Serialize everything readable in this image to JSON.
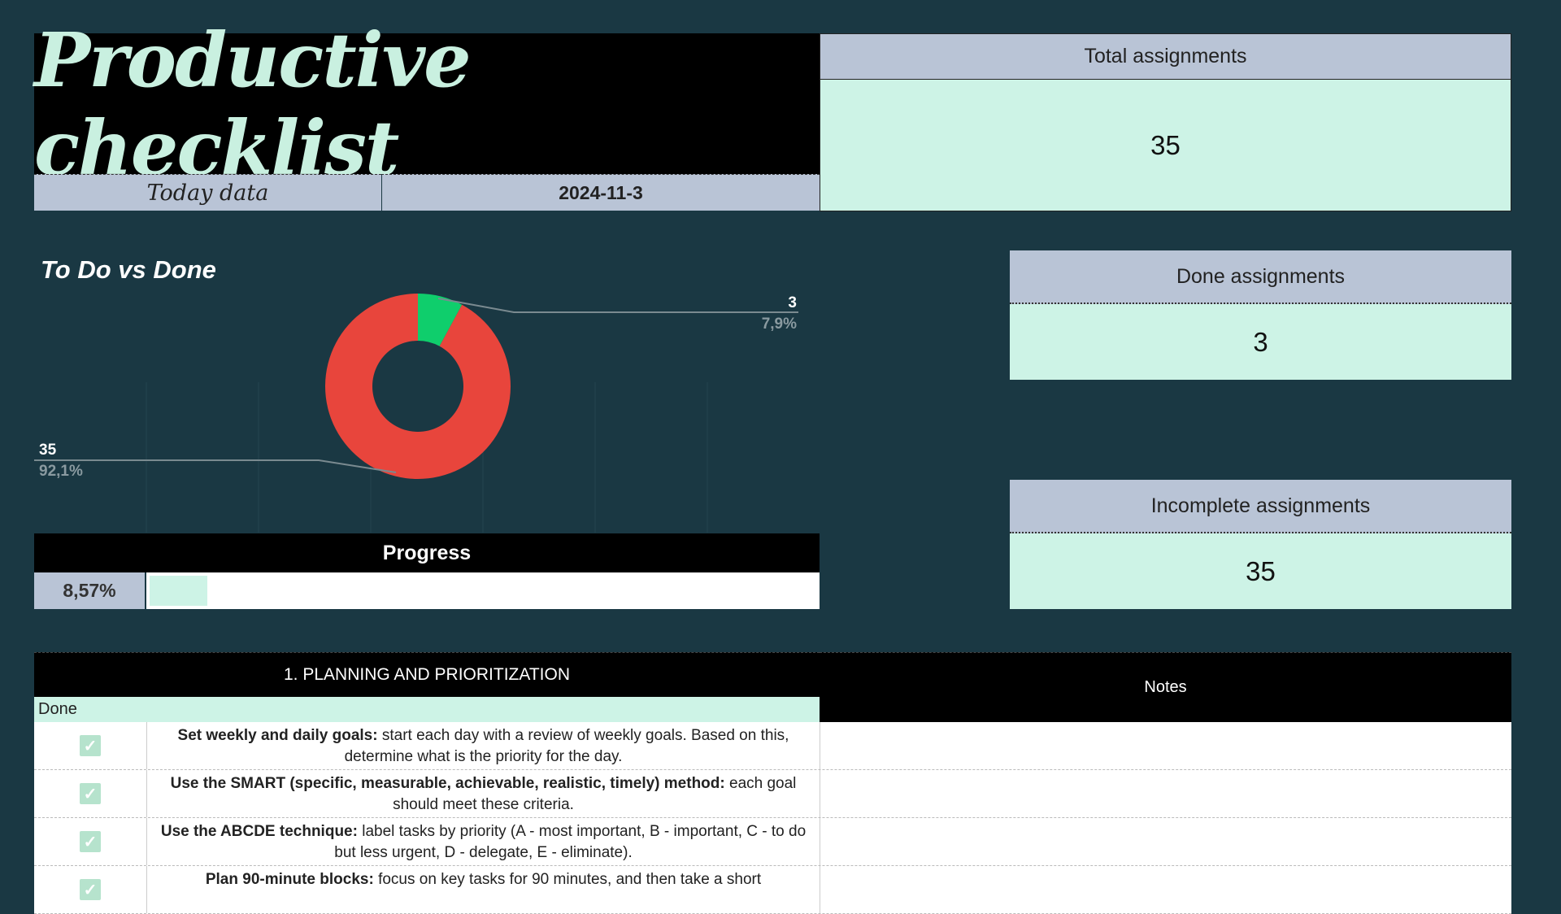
{
  "header": {
    "title": "Productive checklist",
    "today_label": "Today data",
    "today_value": "2024-11-3"
  },
  "stats": {
    "total_label": "Total assignments",
    "total_value": "35",
    "done_label": "Done assignments",
    "done_value": "3",
    "incomplete_label": "Incomplete assignments",
    "incomplete_value": "35"
  },
  "chart_data": {
    "type": "pie",
    "title": "To Do vs Done",
    "donut": true,
    "slices": [
      {
        "value": 3,
        "percent_label": "7,9%",
        "color": "#0fce6c"
      },
      {
        "value": 35,
        "percent_label": "92,1%",
        "color": "#e8453c"
      }
    ],
    "data_labels": [
      "3",
      "7,9%",
      "35",
      "92,1%"
    ]
  },
  "progress": {
    "label": "Progress",
    "value_text": "8,57%",
    "fraction": 0.0857
  },
  "table": {
    "section_title": "1. PLANNING AND PRIORITIZATION",
    "notes_title": "Notes",
    "done_column": "Done",
    "rows": [
      {
        "done": true,
        "bold": "Set weekly and daily goals:",
        "text": " start each day with a review of weekly goals. Based on this, determine what is the priority for the day."
      },
      {
        "done": true,
        "bold": "Use the SMART (specific, measurable, achievable, realistic, timely) method:",
        "text": " each goal should meet these criteria."
      },
      {
        "done": true,
        "bold": "Use the ABCDE technique:",
        "text": " label tasks by priority (A - most important, B - important, C - to do but less urgent, D - delegate, E - eliminate)."
      },
      {
        "done": true,
        "bold": "Plan 90-minute blocks:",
        "text": " focus on key tasks for 90 minutes, and then take a short"
      }
    ]
  },
  "colors": {
    "background": "#1a3843",
    "accent_mint": "#cdf3e6",
    "header_gray": "#b9c4d6",
    "done_slice": "#0fce6c",
    "todo_slice": "#e8453c"
  }
}
